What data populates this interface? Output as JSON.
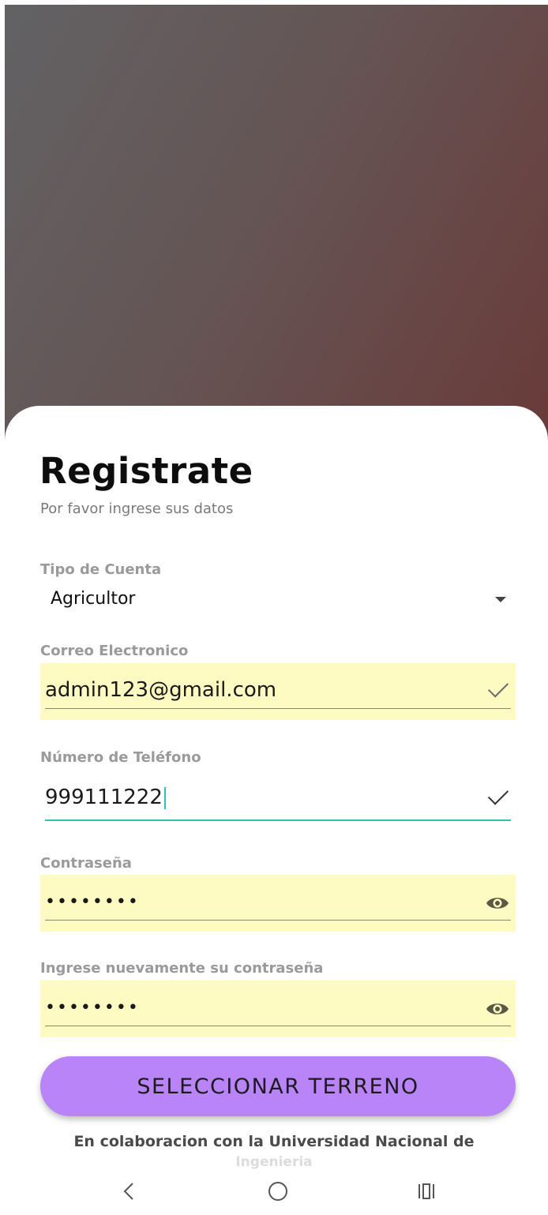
{
  "form": {
    "title": "Registrate",
    "subtitle": "Por favor ingrese sus datos",
    "account_type": {
      "label": "Tipo de Cuenta",
      "value": "Agricultor"
    },
    "email": {
      "label": "Correo Electronico",
      "value": "admin123@gmail.com"
    },
    "phone": {
      "label": "Número de Teléfono",
      "value": "999111222"
    },
    "password": {
      "label": "Contraseña",
      "value": "••••••••"
    },
    "password_confirm": {
      "label": "Ingrese nuevamente su contraseña",
      "value": "••••••••"
    },
    "submit_label": "SELECCIONAR TERRENO"
  },
  "footer": {
    "line1": "En colaboracion con la Universidad Nacional de",
    "line2": "Ingenieria"
  },
  "icons": {
    "check": "check-icon",
    "visibility": "eye-icon",
    "dropdown": "chevron-down-icon",
    "nav_back": "back-icon",
    "nav_home": "home-icon",
    "nav_recent": "recent-apps-icon"
  },
  "colors": {
    "button": "#b884f7",
    "autofill": "#fdfbc2",
    "focus": "#2fc3b8"
  }
}
